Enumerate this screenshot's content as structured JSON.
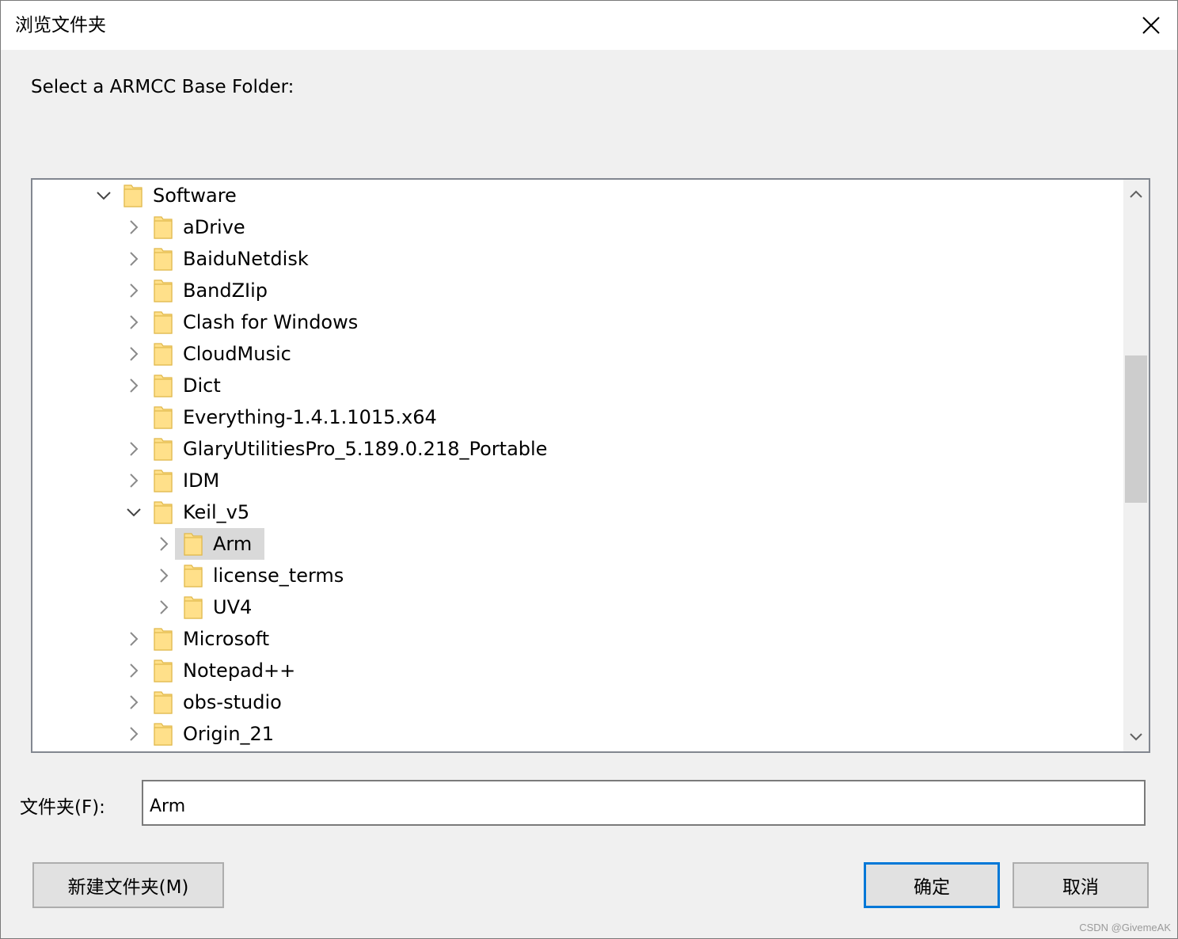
{
  "window": {
    "title": "浏览文件夹"
  },
  "prompt": "Select a ARMCC Base Folder:",
  "tree": {
    "rows": [
      {
        "label": "Software",
        "depth": 0,
        "expander": "expanded",
        "selected": false
      },
      {
        "label": "aDrive",
        "depth": 1,
        "expander": "collapsed",
        "selected": false
      },
      {
        "label": "BaiduNetdisk",
        "depth": 1,
        "expander": "collapsed",
        "selected": false
      },
      {
        "label": "BandZIip",
        "depth": 1,
        "expander": "collapsed",
        "selected": false
      },
      {
        "label": "Clash for Windows",
        "depth": 1,
        "expander": "collapsed",
        "selected": false
      },
      {
        "label": "CloudMusic",
        "depth": 1,
        "expander": "collapsed",
        "selected": false
      },
      {
        "label": "Dict",
        "depth": 1,
        "expander": "collapsed",
        "selected": false
      },
      {
        "label": "Everything-1.4.1.1015.x64",
        "depth": 1,
        "expander": "none",
        "selected": false
      },
      {
        "label": "GlaryUtilitiesPro_5.189.0.218_Portable",
        "depth": 1,
        "expander": "collapsed",
        "selected": false
      },
      {
        "label": "IDM",
        "depth": 1,
        "expander": "collapsed",
        "selected": false
      },
      {
        "label": "Keil_v5",
        "depth": 1,
        "expander": "expanded",
        "selected": false
      },
      {
        "label": "Arm",
        "depth": 2,
        "expander": "collapsed",
        "selected": true
      },
      {
        "label": "license_terms",
        "depth": 2,
        "expander": "collapsed",
        "selected": false
      },
      {
        "label": "UV4",
        "depth": 2,
        "expander": "collapsed",
        "selected": false
      },
      {
        "label": "Microsoft",
        "depth": 1,
        "expander": "collapsed",
        "selected": false
      },
      {
        "label": "Notepad++",
        "depth": 1,
        "expander": "collapsed",
        "selected": false
      },
      {
        "label": "obs-studio",
        "depth": 1,
        "expander": "collapsed",
        "selected": false
      },
      {
        "label": "Origin_21",
        "depth": 1,
        "expander": "collapsed",
        "selected": false
      }
    ]
  },
  "folder_field": {
    "label": "文件夹(F):",
    "value": "Arm"
  },
  "buttons": {
    "new_folder": "新建文件夹(M)",
    "ok": "确定",
    "cancel": "取消"
  },
  "watermark": "CSDN @GivemeAK",
  "colors": {
    "folder_fill": "#ffe08a",
    "folder_edge": "#e0b84a",
    "selection": "#d9d9d9",
    "focus_border": "#0078d7"
  },
  "icons": {
    "close": "close-icon",
    "folder": "folder-icon",
    "expanded": "chevron-down-icon",
    "collapsed": "chevron-right-icon",
    "scroll_up": "chevron-up-icon",
    "scroll_down": "chevron-down-icon"
  }
}
